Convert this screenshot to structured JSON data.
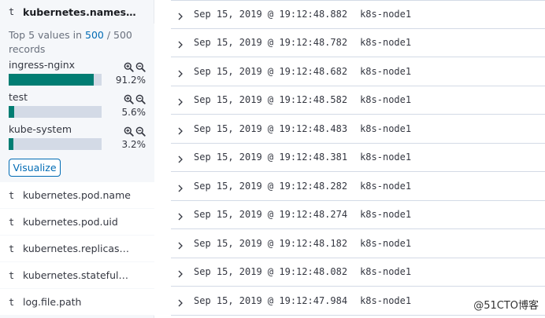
{
  "sidebar": {
    "selected_field": {
      "type": "t",
      "name": "kubernetes.names…"
    },
    "details": {
      "top_prefix": "Top 5 values in ",
      "top_count": "500",
      "top_sep": " / ",
      "top_total": "500",
      "top_suffix": "records",
      "values": [
        {
          "name": "ingress-nginx",
          "percent": "91.2%",
          "fraction": 0.912
        },
        {
          "name": "test",
          "percent": "5.6%",
          "fraction": 0.056
        },
        {
          "name": "kube-system",
          "percent": "3.2%",
          "fraction": 0.032
        }
      ],
      "visualize_label": "Visualize"
    },
    "fields": [
      {
        "type": "t",
        "name": "kubernetes.pod.name"
      },
      {
        "type": "t",
        "name": "kubernetes.pod.uid"
      },
      {
        "type": "t",
        "name": "kubernetes.replicas…"
      },
      {
        "type": "t",
        "name": "kubernetes.stateful…"
      },
      {
        "type": "t",
        "name": "log.file.path"
      }
    ]
  },
  "documents": [
    {
      "timestamp": "Sep 15, 2019 @ 19:12:48.882",
      "host": "k8s-node1"
    },
    {
      "timestamp": "Sep 15, 2019 @ 19:12:48.782",
      "host": "k8s-node1"
    },
    {
      "timestamp": "Sep 15, 2019 @ 19:12:48.682",
      "host": "k8s-node1"
    },
    {
      "timestamp": "Sep 15, 2019 @ 19:12:48.582",
      "host": "k8s-node1"
    },
    {
      "timestamp": "Sep 15, 2019 @ 19:12:48.483",
      "host": "k8s-node1"
    },
    {
      "timestamp": "Sep 15, 2019 @ 19:12:48.381",
      "host": "k8s-node1"
    },
    {
      "timestamp": "Sep 15, 2019 @ 19:12:48.282",
      "host": "k8s-node1"
    },
    {
      "timestamp": "Sep 15, 2019 @ 19:12:48.274",
      "host": "k8s-node1"
    },
    {
      "timestamp": "Sep 15, 2019 @ 19:12:48.182",
      "host": "k8s-node1"
    },
    {
      "timestamp": "Sep 15, 2019 @ 19:12:48.082",
      "host": "k8s-node1"
    },
    {
      "timestamp": "Sep 15, 2019 @ 19:12:47.984",
      "host": "k8s-node1"
    }
  ],
  "watermark": "@51CTO博客",
  "colors": {
    "bar_fill": "#017d73",
    "bar_track": "#d3dae6",
    "link": "#006bb4"
  },
  "icons": {
    "filter_in": "zoom-in-icon",
    "filter_out": "zoom-out-icon",
    "expand": "chevron-right-icon"
  }
}
